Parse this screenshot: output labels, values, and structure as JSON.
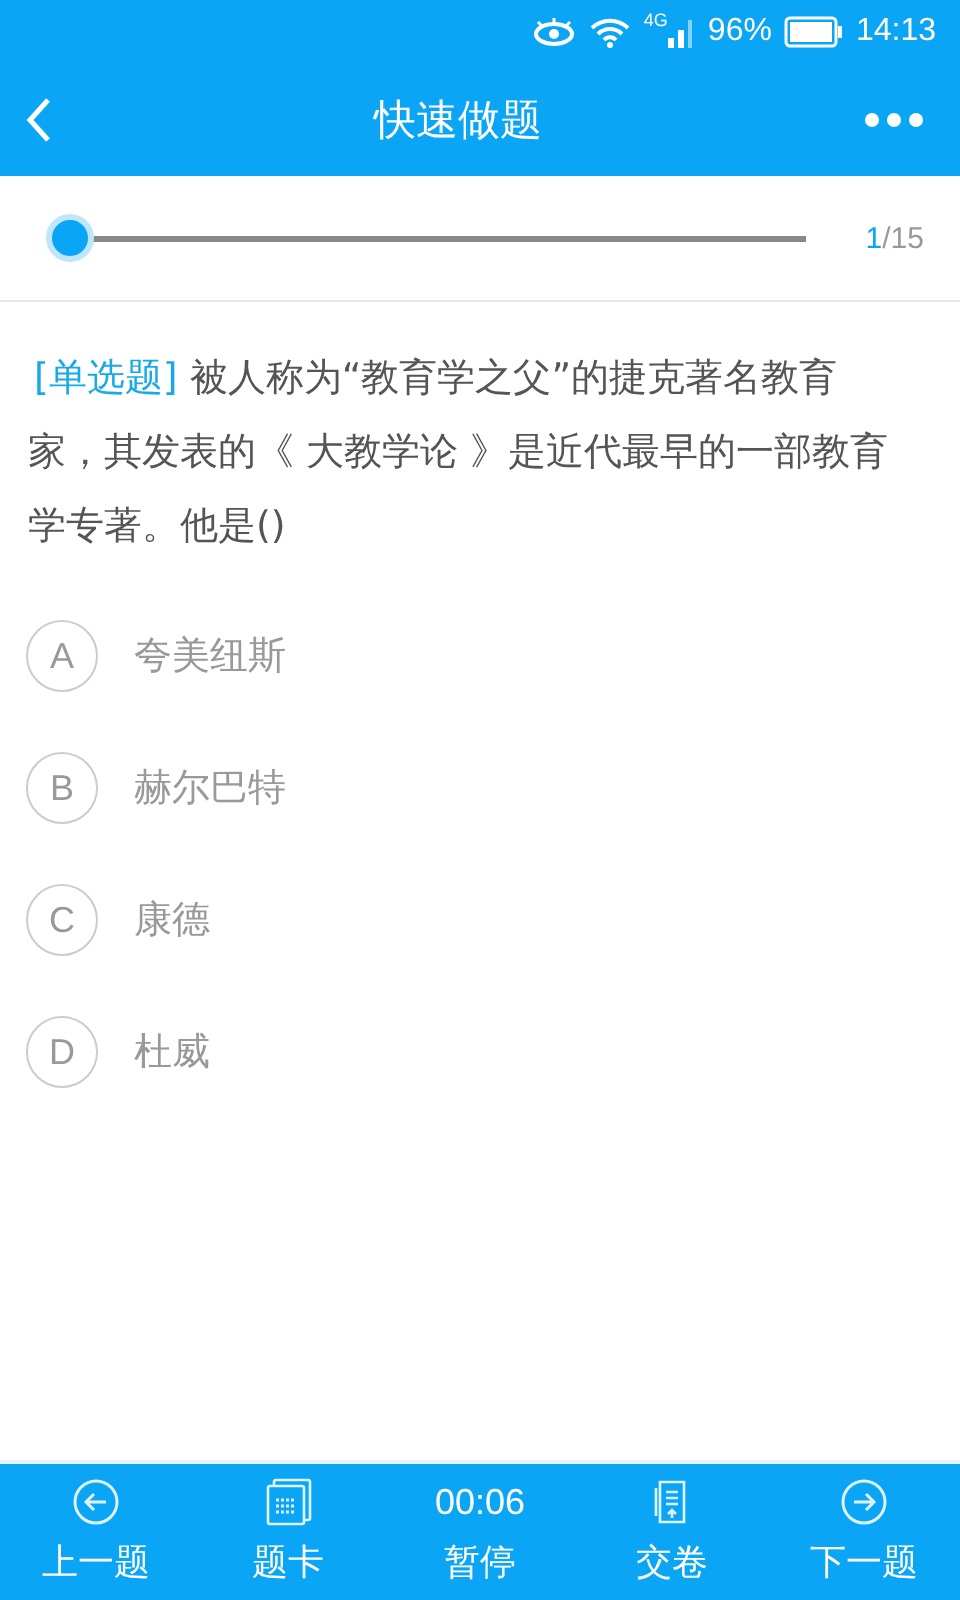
{
  "status_bar": {
    "network": "4G",
    "battery": "96%",
    "time": "14:13"
  },
  "header": {
    "title": "快速做题"
  },
  "progress": {
    "level": 0,
    "current": "1",
    "total": "/15"
  },
  "question": {
    "type": "[单选题]",
    "text": "被人称为“教育学之父”的捷克著名教育家，其发表的《 大教学论 》是近代最早的一部教育学专著。他是()"
  },
  "options": [
    {
      "letter": "A",
      "text": "夸美纽斯",
      "selected": false
    },
    {
      "letter": "B",
      "text": "赫尔巴特",
      "selected": false
    },
    {
      "letter": "C",
      "text": "康德",
      "selected": false
    },
    {
      "letter": "D",
      "text": "杜威",
      "selected": false
    }
  ],
  "footer": [
    {
      "kind": "prev",
      "label": "上一题"
    },
    {
      "kind": "card",
      "label": "题卡"
    },
    {
      "kind": "timer",
      "time": "00:06",
      "label": "暂停"
    },
    {
      "kind": "submit",
      "label": "交卷"
    },
    {
      "kind": "next",
      "label": "下一题"
    }
  ]
}
